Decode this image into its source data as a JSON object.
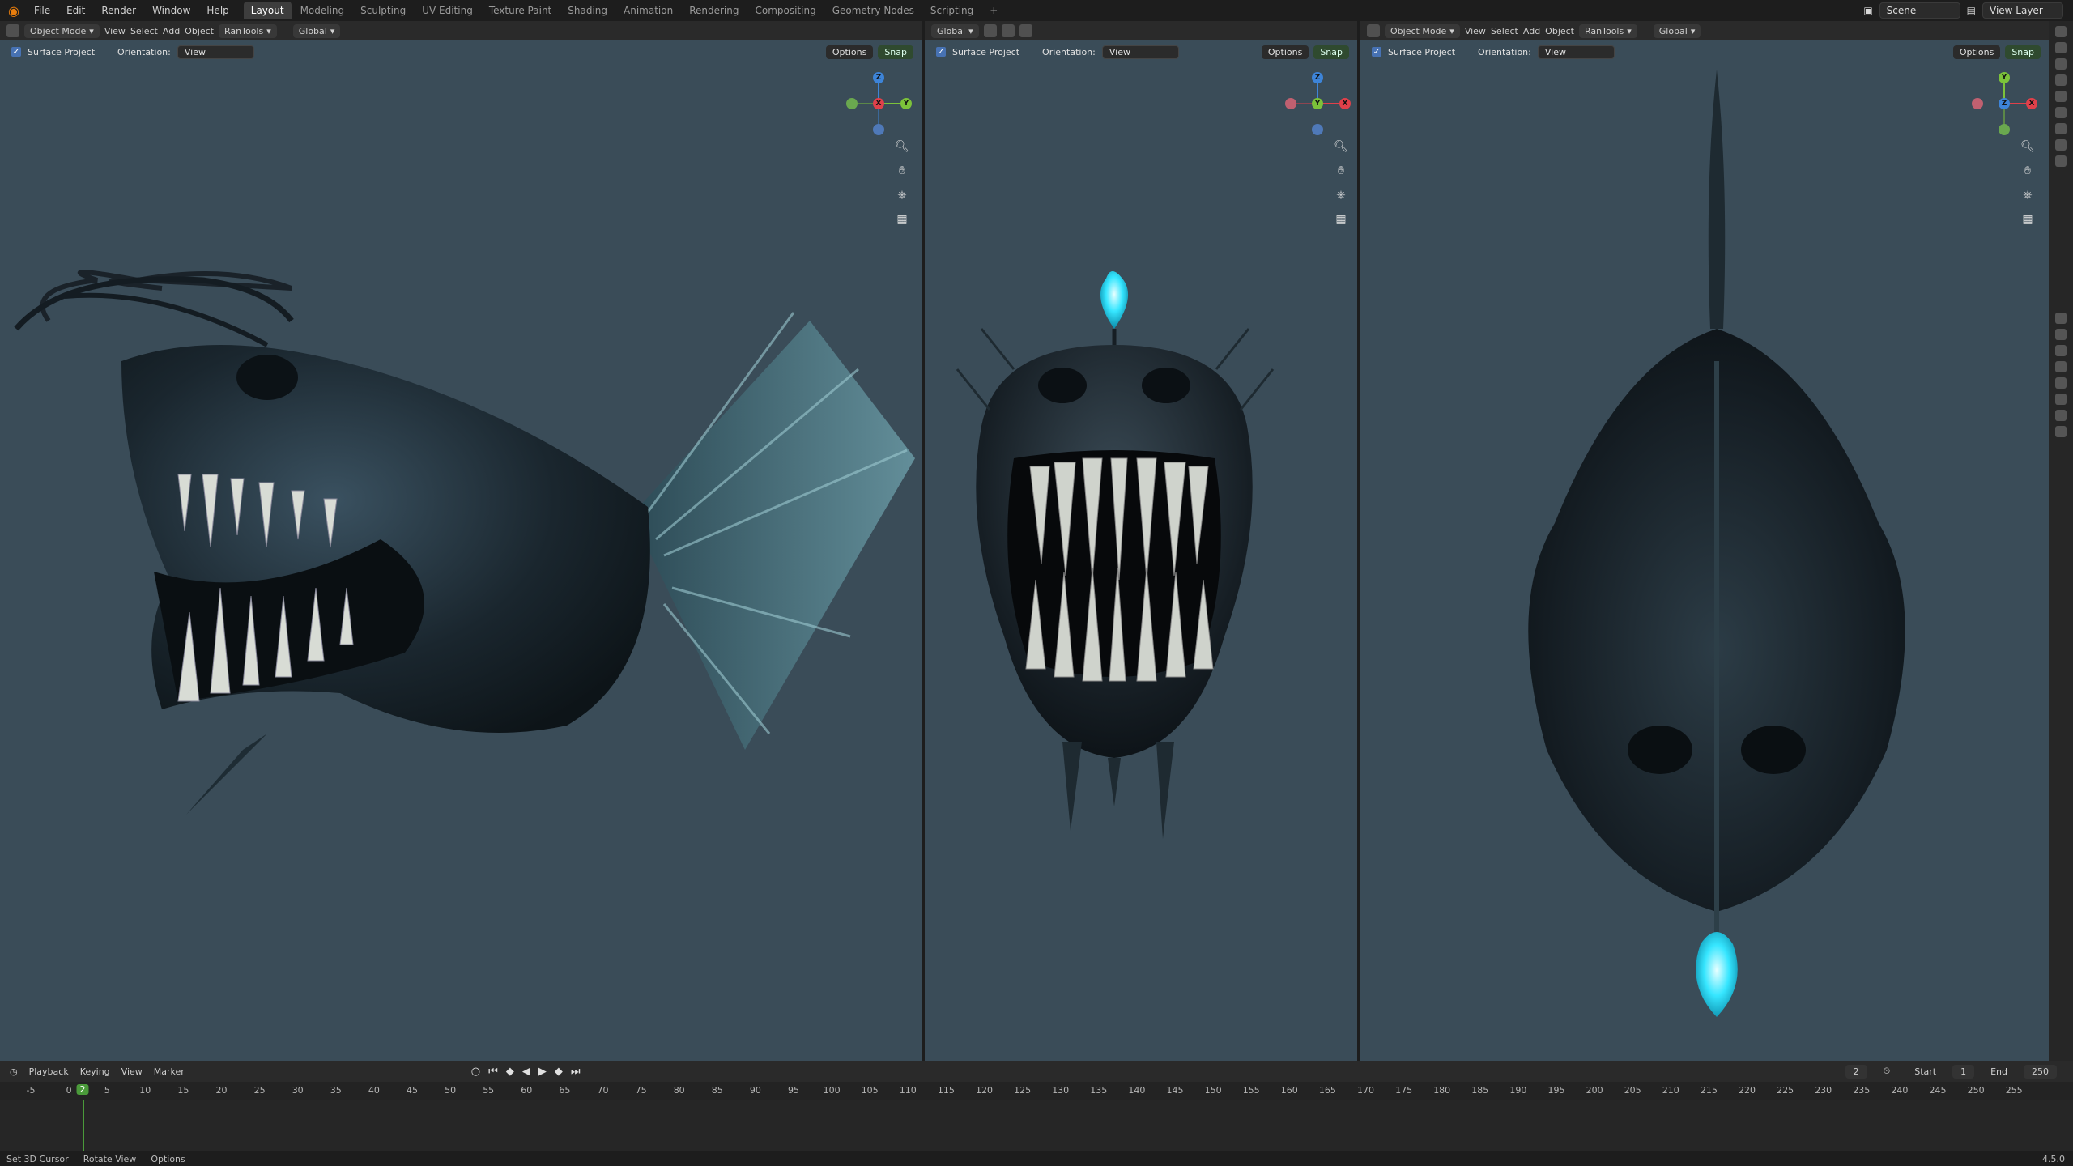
{
  "menu": [
    "File",
    "Edit",
    "Render",
    "Window",
    "Help"
  ],
  "workspaces": [
    "Layout",
    "Modeling",
    "Sculpting",
    "UV Editing",
    "Texture Paint",
    "Shading",
    "Animation",
    "Rendering",
    "Compositing",
    "Geometry Nodes",
    "Scripting"
  ],
  "active_workspace": "Layout",
  "top_right": {
    "scene": "Scene",
    "view_layer": "View Layer"
  },
  "viewport": {
    "mode": "Object Mode",
    "menus": [
      "View",
      "Select",
      "Add",
      "Object",
      "RanTools"
    ],
    "transform": "Global",
    "surface_project": "Surface Project",
    "orientation_label": "Orientation:",
    "orientation_value": "View",
    "options": "Options",
    "snap": "Snap"
  },
  "gizmo_axes": [
    "X",
    "Y",
    "Z"
  ],
  "timeline": {
    "menus": [
      "Playback",
      "Keying",
      "View",
      "Marker"
    ],
    "current_frame": "2",
    "start_label": "Start",
    "start": "1",
    "end_label": "End",
    "end": "250",
    "ticks": [
      "-5",
      "0",
      "5",
      "10",
      "15",
      "20",
      "25",
      "30",
      "35",
      "40",
      "45",
      "50",
      "55",
      "60",
      "65",
      "70",
      "75",
      "80",
      "85",
      "90",
      "95",
      "100",
      "105",
      "110",
      "115",
      "120",
      "125",
      "130",
      "135",
      "140",
      "145",
      "150",
      "155",
      "160",
      "165",
      "170",
      "175",
      "180",
      "185",
      "190",
      "195",
      "200",
      "205",
      "210",
      "215",
      "220",
      "225",
      "230",
      "235",
      "240",
      "245",
      "250",
      "255"
    ]
  },
  "status": {
    "set_cursor": "Set 3D Cursor",
    "rotate": "Rotate View",
    "options": "Options",
    "version": "4.5.0"
  },
  "colors": {
    "x_axis": "#e0404a",
    "y_axis": "#7cc23a",
    "z_axis": "#3d84d8",
    "lure": "#36e6ff",
    "frame_cursor": "#4a9a3a"
  }
}
